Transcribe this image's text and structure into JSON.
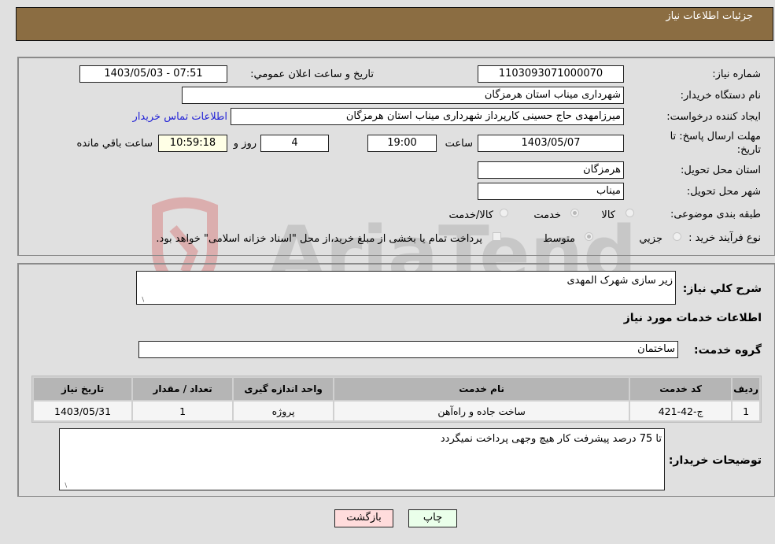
{
  "header": {
    "title": "جزئیات اطلاعات نیاز"
  },
  "form": {
    "need_number": {
      "label": "شماره نیاز:",
      "value": "1103093071000070"
    },
    "announce_datetime": {
      "label": "تاریخ و ساعت اعلان عمومي:",
      "value": "1403/05/03 - 07:51"
    },
    "buyer_org": {
      "label": "نام دستگاه خریدار:",
      "value": "شهرداری میناب استان هرمزگان"
    },
    "requester": {
      "label": "ایجاد کننده درخواست:",
      "value": "میرزامهدی حاج حسینی کارپرداز شهرداری میناب استان هرمزگان"
    },
    "buyer_contact_link": "اطلاعات تماس خریدار",
    "deadline": {
      "label": "مهلت ارسال پاسخ: تا تاریخ:",
      "date": "1403/05/07",
      "time_label": "ساعت",
      "time": "19:00",
      "days": "4",
      "days_label": "روز و",
      "remaining": "10:59:18",
      "remaining_label": "ساعت باقي مانده"
    },
    "delivery_province": {
      "label": "استان محل تحویل:",
      "value": "هرمزگان"
    },
    "delivery_city": {
      "label": "شهر محل تحویل:",
      "value": "میناب"
    },
    "category": {
      "label": "طبقه بندی موضوعی:",
      "options": [
        "کالا",
        "خدمت",
        "کالا/خدمت"
      ],
      "selected": "خدمت"
    },
    "purchase_type": {
      "label": "نوع فرآیند خرید :",
      "options": [
        "جزيي",
        "متوسط"
      ],
      "selected": "متوسط",
      "treasury_note": "پرداخت تمام یا بخشی از مبلغ خرید،از محل \"اسناد خزانه اسلامی\" خواهد بود.",
      "treasury_checked": false
    }
  },
  "details": {
    "description_label": "شرح کلي نیاز:",
    "description": "زیر سازی شهرک المهدی",
    "services_heading": "اطلاعات خدمات مورد نیاز",
    "service_group_label": "گروه خدمت:",
    "service_group": "ساختمان",
    "table": {
      "headers": [
        "ردیف",
        "کد خدمت",
        "نام خدمت",
        "واحد اندازه گیری",
        "تعداد / مقدار",
        "تاریخ نیاز"
      ],
      "rows": [
        [
          "1",
          "ج-42-421",
          "ساخت جاده و راه‌آهن",
          "پروژه",
          "1",
          "1403/05/31"
        ]
      ]
    },
    "buyer_notes_label": "توضیحات خریدار:",
    "buyer_notes": "تا 75 درصد پیشرفت کار هیچ وجهی پرداخت نمیگردد"
  },
  "buttons": {
    "print": "چاپ",
    "back": "بازگشت"
  },
  "watermark": {
    "text": "AriaTender.neT"
  },
  "colors": {
    "header_bg": "#8b6d42",
    "print_bg": "#eaffea",
    "back_bg": "#ffdcdc",
    "remaining_bg": "#ffffe6",
    "link": "#2323d6"
  }
}
